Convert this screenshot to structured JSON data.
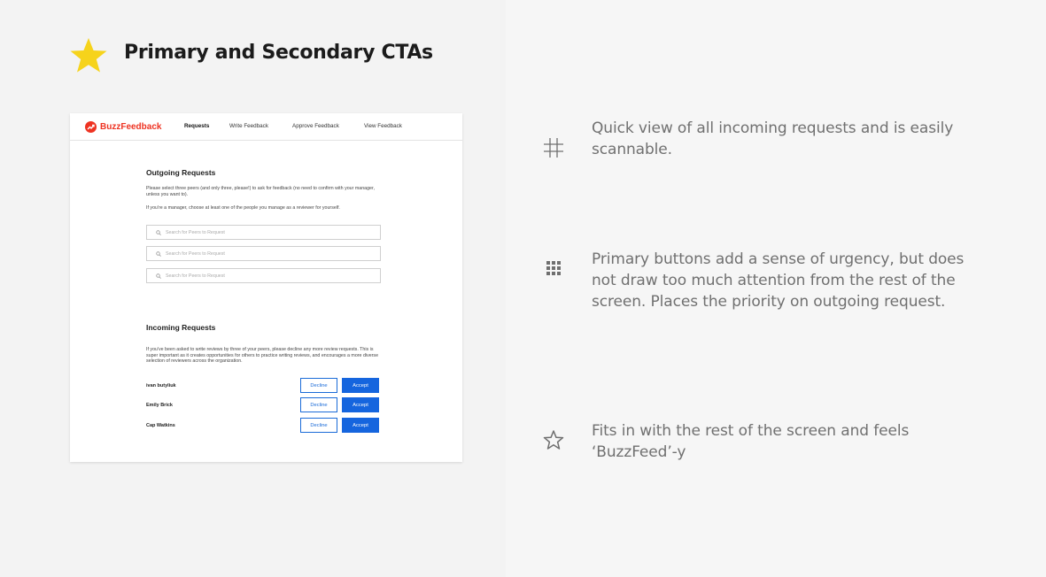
{
  "header": {
    "title": "Primary and Secondary CTAs",
    "star_icon": "star-icon",
    "star_color": "#f6d31b"
  },
  "mock": {
    "brand": "BuzzFeedback",
    "brand_color": "#ee3322",
    "nav": [
      "Requests",
      "Write Feedback",
      "Approve Feedback",
      "View Feedback"
    ],
    "outgoing": {
      "title": "Outgoing Requests",
      "desc1": "Please select three peers (and only three, please!) to ask for feedback (no need to confirm with your manager, unless you want to).",
      "desc2": "If you're a manager, choose at least one of the people you manage as a reviewer for yourself.",
      "search_placeholder": "Search for Peers to Request"
    },
    "incoming": {
      "title": "Incoming Requests",
      "desc": "If you've been asked to write reviews by three of your peers, please decline any more review requests. This is super important as it creates opportunities for others to practice writing reviews, and encourages a more diverse selection of reviewers across the organization.",
      "requests": [
        {
          "name": "ivan butyliuk"
        },
        {
          "name": "Emily Brick"
        },
        {
          "name": "Cap Watkins"
        }
      ],
      "decline_label": "Decline",
      "accept_label": "Accept"
    },
    "accent_color": "#1565de"
  },
  "features": [
    {
      "icon": "hash-icon",
      "text": "Quick view of all incoming requests and is easily scannable."
    },
    {
      "icon": "grid-icon",
      "text": "Primary buttons add a sense of urgency, but does not draw too much attention from the rest of the screen. Places the priority on outgoing request."
    },
    {
      "icon": "star-outline-icon",
      "text": "Fits in with the rest of the screen and feels ‘BuzzFeed’-y"
    }
  ]
}
